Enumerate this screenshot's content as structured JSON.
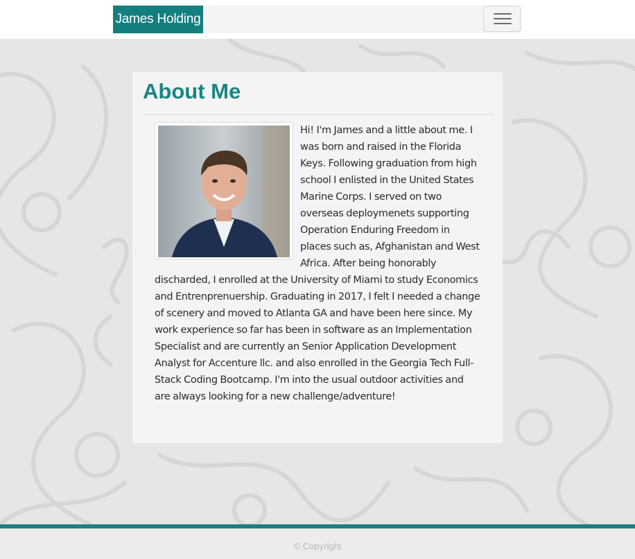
{
  "navbar": {
    "brand": "James Holding",
    "toggler_icon": "hamburger-menu-icon"
  },
  "about": {
    "title": "About Me",
    "photo_alt": "Portrait of James Holding",
    "bio": "Hi! I'm James and a little about me. I was born and raised in the Florida Keys. Following graduation from high school I enlisted in the United States Marine Corps. I served on two overseas deploymenets supporting Operation Enduring Freedom in places such as, Afghanistan and West Africa. After being honorably discharded, I enrolled at the University of Miami to study Economics and Entrenprenuership. Graduating in 2017, I felt I needed a change of scenery and moved to Atlanta GA and have been here since. My work experience so far has been in software as an Implementation Specialist and are currently an Senior Application Development Analyst for Accenture llc. and also enrolled in the Georgia Tech Full-Stack Coding Bootcamp. I'm into the usual outdoor activities and are always looking for a new challenge/adventure!"
  },
  "footer": {
    "copyright": "© Copyright"
  },
  "colors": {
    "accent": "#137f7f",
    "title": "#188585",
    "footer_border": "#1a8080"
  }
}
